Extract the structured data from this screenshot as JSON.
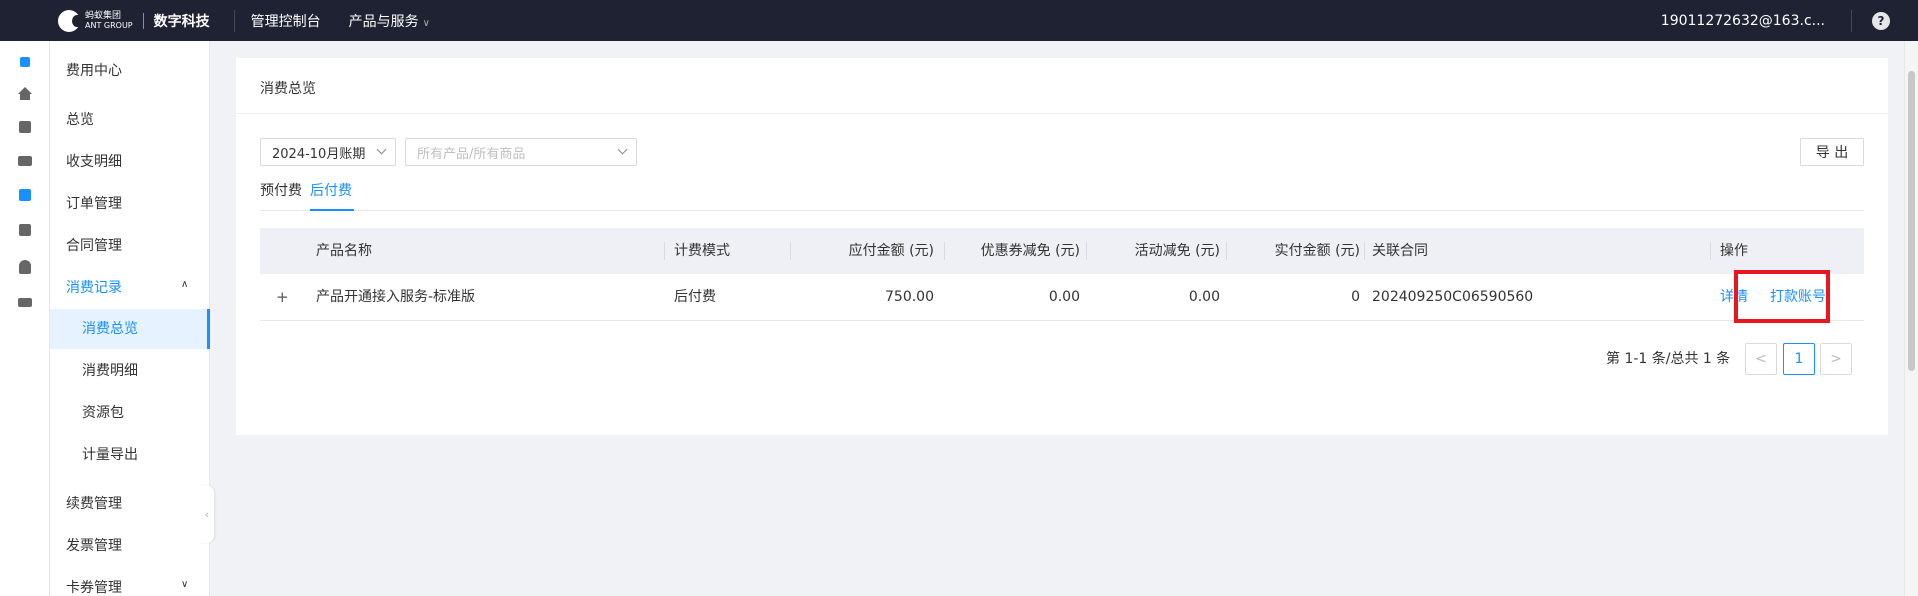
{
  "topbar": {
    "logo_cn": "蚂蚁集团",
    "logo_en": "ANT GROUP",
    "brand": "数字科技",
    "nav": [
      "管理控制台",
      "产品与服务"
    ],
    "user_email": "19011272632@163.c...",
    "help": "?"
  },
  "sidemenu": {
    "title": "费用中心",
    "items": [
      "总览",
      "收支明细",
      "订单管理",
      "合同管理",
      "消费记录"
    ],
    "sub_items": [
      "消费总览",
      "消费明细",
      "资源包",
      "计量导出"
    ],
    "more_items": [
      "续费管理",
      "发票管理",
      "卡券管理"
    ]
  },
  "main": {
    "title": "消费总览",
    "period_select": "2024-10月账期",
    "product_select_placeholder": "所有产品/所有商品",
    "export_label": "导 出",
    "tabs": [
      "预付费",
      "后付费"
    ],
    "active_tab": "后付费",
    "table": {
      "columns": [
        "产品名称",
        "计费模式",
        "应付金额 (元)",
        "优惠券减免 (元)",
        "活动减免 (元)",
        "实付金额 (元)",
        "关联合同",
        "操作"
      ],
      "rows": [
        {
          "expand": "+",
          "product": "产品开通接入服务-标准版",
          "billing_mode": "后付费",
          "payable": "750.00",
          "coupon": "0.00",
          "activity": "0.00",
          "paid": "0",
          "contract": "202409250C06590560",
          "actions": [
            "详情",
            "打款账号"
          ]
        }
      ]
    },
    "pagination": {
      "summary": "第 1-1 条/总共 1 条",
      "prev": "<",
      "current": "1",
      "next": ">"
    }
  }
}
